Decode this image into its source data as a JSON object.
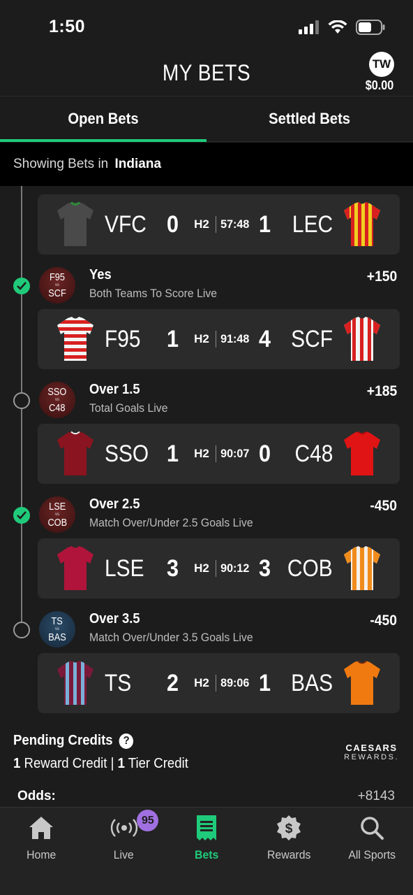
{
  "status_bar": {
    "time": "1:50"
  },
  "header": {
    "title": "MY BETS",
    "avatar_initials": "TW",
    "balance": "$0.00"
  },
  "tabs": [
    {
      "label": "Open Bets",
      "active": true
    },
    {
      "label": "Settled Bets",
      "active": false
    }
  ],
  "location": {
    "prefix": "Showing Bets in",
    "state": "Indiana"
  },
  "legs": [
    {
      "status": "hidden",
      "game": {
        "home_team": "VFC",
        "home_score": "0",
        "half": "H2",
        "clock": "57:48",
        "away_score": "1",
        "away_team": "LEC",
        "home_jersey": "grey",
        "away_jersey": "red-yellow-stripes"
      }
    },
    {
      "status": "won",
      "badge_top": "F95",
      "badge_bottom": "SCF",
      "badge_vs": "vs",
      "selection": "Yes",
      "market": "Both Teams To Score Live",
      "odds": "+150",
      "game": {
        "home_team": "F95",
        "home_score": "1",
        "half": "H2",
        "clock": "91:48",
        "away_score": "4",
        "away_team": "SCF",
        "home_jersey": "red-white-hoops",
        "away_jersey": "red-white-stripes"
      }
    },
    {
      "status": "open",
      "badge_top": "SSO",
      "badge_bottom": "C48",
      "badge_vs": "vs",
      "selection": "Over 1.5",
      "market": "Total Goals Live",
      "odds": "+185",
      "game": {
        "home_team": "SSO",
        "home_score": "1",
        "half": "H2",
        "clock": "90:07",
        "away_score": "0",
        "away_team": "C48",
        "home_jersey": "maroon",
        "away_jersey": "red"
      }
    },
    {
      "status": "won",
      "badge_top": "LSE",
      "badge_bottom": "COB",
      "badge_vs": "vs",
      "selection": "Over 2.5",
      "market": "Match Over/Under 2.5 Goals Live",
      "odds": "-450",
      "game": {
        "home_team": "LSE",
        "home_score": "3",
        "half": "H2",
        "clock": "90:12",
        "away_score": "3",
        "away_team": "COB",
        "home_jersey": "crimson",
        "away_jersey": "orange-white-stripes"
      }
    },
    {
      "status": "open",
      "badge_top": "TS",
      "badge_bottom": "BAS",
      "badge_vs": "vs",
      "selection": "Over 3.5",
      "market": "Match Over/Under 3.5 Goals Live",
      "odds": "-450",
      "game": {
        "home_team": "TS",
        "home_score": "2",
        "half": "H2",
        "clock": "89:06",
        "away_score": "1",
        "away_team": "BAS",
        "home_jersey": "claret-blue-stripes",
        "away_jersey": "orange"
      }
    }
  ],
  "pending_credits": {
    "title": "Pending Credits",
    "reward_count": "1",
    "reward_label": "Reward Credit",
    "separator": "|",
    "tier_count": "1",
    "tier_label": "Tier Credit",
    "brand_top": "CAESARS",
    "brand_bottom": "REWARDS."
  },
  "odds_summary": {
    "label": "Odds:",
    "value": "+8143"
  },
  "nav": [
    {
      "label": "Home",
      "icon": "home-icon",
      "active": false
    },
    {
      "label": "Live",
      "icon": "live-broadcast-icon",
      "active": false,
      "badge": "95"
    },
    {
      "label": "Bets",
      "icon": "bet-slip-icon",
      "active": true
    },
    {
      "label": "Rewards",
      "icon": "rewards-dollar-icon",
      "active": false
    },
    {
      "label": "All Sports",
      "icon": "search-icon",
      "active": false
    }
  ],
  "colors": {
    "accent": "#1fcb7a",
    "background": "#1c1c1c",
    "card": "#2b2b2b",
    "live_badge": "#a070e0"
  }
}
